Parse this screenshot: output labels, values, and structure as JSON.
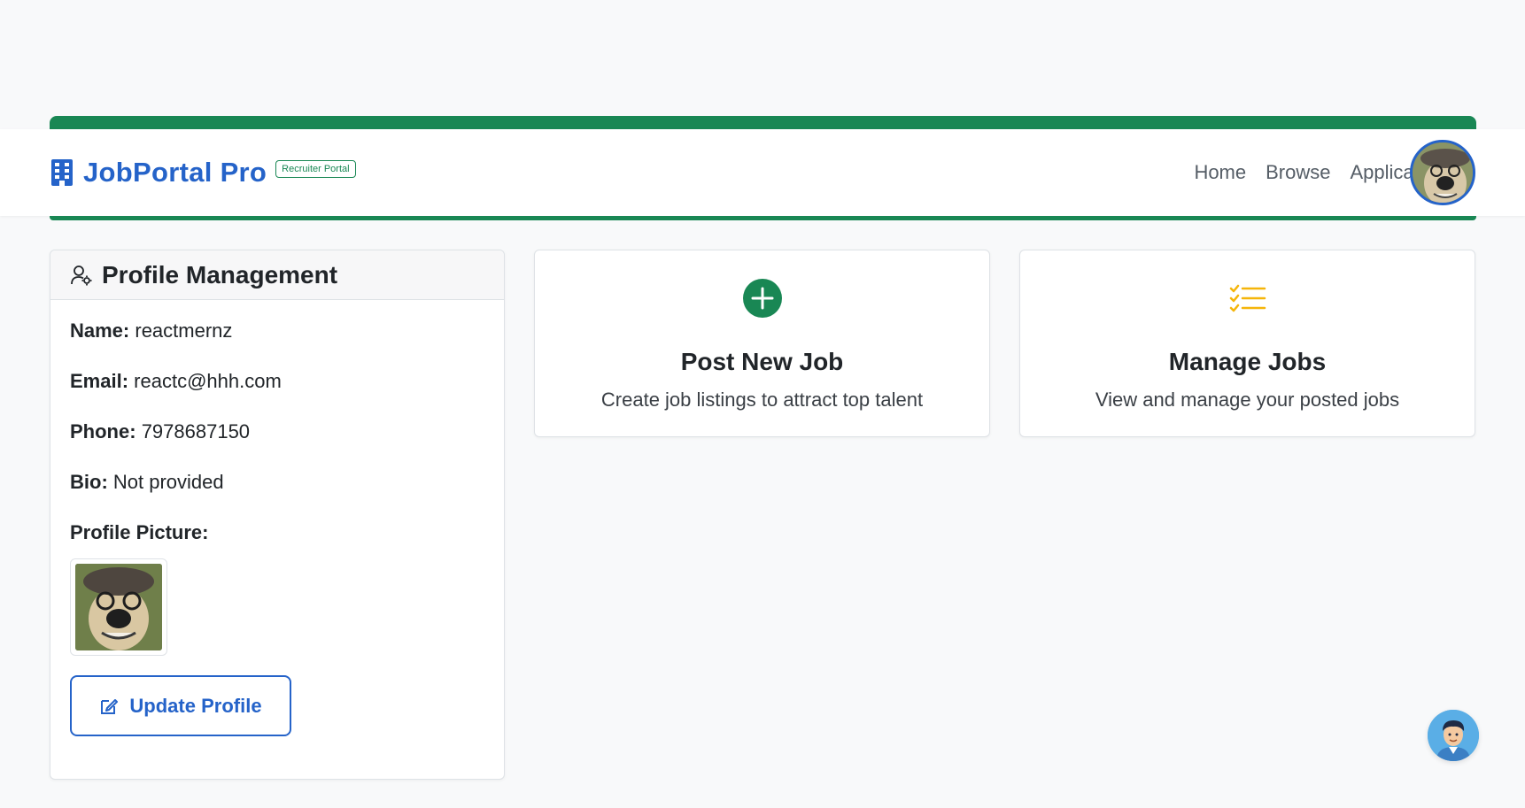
{
  "navbar": {
    "brand": "JobPortal Pro",
    "badge": "Recruiter Portal",
    "links": [
      "Home",
      "Browse",
      "Applicants"
    ]
  },
  "profile": {
    "title": "Profile Management",
    "name_label": "Name:",
    "name_value": "reactmernz",
    "email_label": "Email:",
    "email_value": "reactc@hhh.com",
    "phone_label": "Phone:",
    "phone_value": "7978687150",
    "bio_label": "Bio:",
    "bio_value": "Not provided",
    "picture_label": "Profile Picture:",
    "update_button": "Update Profile"
  },
  "cards": {
    "post": {
      "title": "Post New Job",
      "description": "Create job listings to attract top talent"
    },
    "manage": {
      "title": "Manage Jobs",
      "description": "View and manage your posted jobs"
    }
  },
  "colors": {
    "accent_green": "#198754",
    "brand_blue": "#2563c9",
    "manage_icon_yellow": "#f5b50a"
  }
}
